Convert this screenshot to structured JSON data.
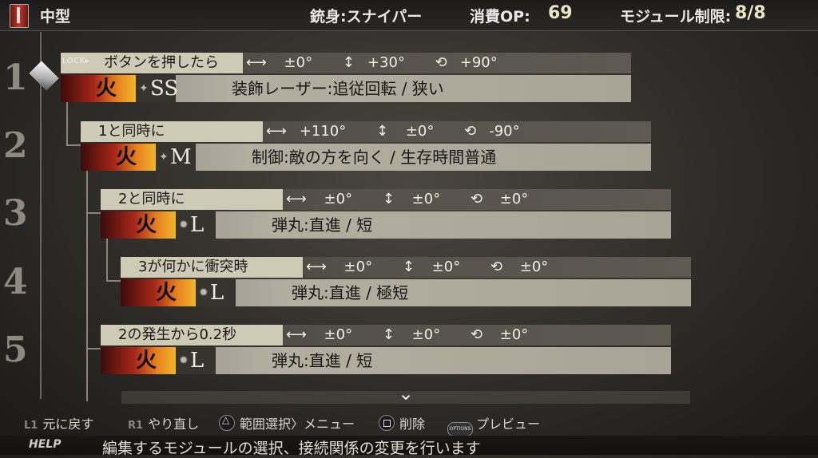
{
  "header": {
    "category": "中型",
    "barrel_label": "銃身:スナイパー",
    "cost_label": "消費OP:",
    "cost_value": "69",
    "limit_label": "モジュール制限:",
    "limit_value": "8/8"
  },
  "row_numbers": [
    "1",
    "2",
    "3",
    "4",
    "5"
  ],
  "lock_badge": "LOCK▸",
  "modules": [
    {
      "condition": "ボタンを押したら",
      "horizontal": "±0°",
      "vertical": "+30°",
      "rotation": "+90°",
      "element": "火",
      "size": "SS",
      "description": "装飾レーザー:追従回転 / 狭い"
    },
    {
      "condition": "1と同時に",
      "horizontal": "+110°",
      "vertical": "±0°",
      "rotation": "-90°",
      "element": "火",
      "size": "M",
      "description": "制御:敵の方を向く / 生存時間普通"
    },
    {
      "condition": "2と同時に",
      "horizontal": "±0°",
      "vertical": "±0°",
      "rotation": "±0°",
      "element": "火",
      "size": "L",
      "description": "弾丸:直進 / 短"
    },
    {
      "condition": "3が何かに衝突時",
      "horizontal": "±0°",
      "vertical": "±0°",
      "rotation": "±0°",
      "element": "火",
      "size": "L",
      "description": "弾丸:直進 / 極短"
    },
    {
      "condition": "2の発生から0.2秒",
      "horizontal": "±0°",
      "vertical": "±0°",
      "rotation": "±0°",
      "element": "火",
      "size": "L",
      "description": "弾丸:直進 / 短"
    }
  ],
  "controls": {
    "undo_key": "L1",
    "undo_label": "元に戻す",
    "redo_key": "R1",
    "redo_label": "やり直し",
    "range_label": "範囲選択〉メニュー",
    "delete_label": "削除",
    "options_key": "OPTIONS",
    "preview_label": "プレビュー"
  },
  "help": {
    "label": "HELP",
    "text": "編集するモジュールの選択、接続関係の変更を行います"
  },
  "colors": {
    "accent": "#cfcab6",
    "fire": "#e7811f"
  }
}
